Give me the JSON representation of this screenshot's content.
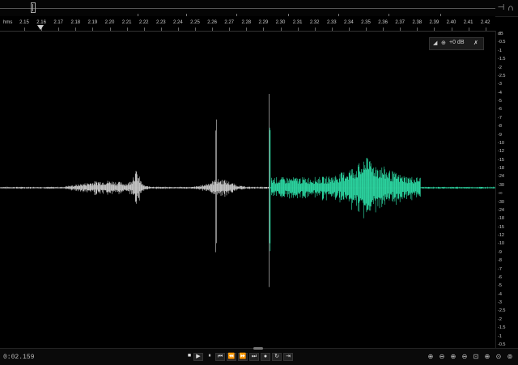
{
  "overview": {
    "end_icon": "⊣",
    "zoom_icon": "∩"
  },
  "ruler": {
    "unit": "hms",
    "ticks": [
      "2.15",
      "2.16",
      "2.17",
      "2.18",
      "2.19",
      "2.20",
      "2.21",
      "2.22",
      "2.23",
      "2.24",
      "2.25",
      "2.26",
      "2.27",
      "2.28",
      "2.29",
      "2.30",
      "2.31",
      "2.32",
      "2.33",
      "2.34",
      "2.35",
      "2.36",
      "2.37",
      "2.38",
      "2.39",
      "2.40",
      "2.41",
      "2.42"
    ]
  },
  "db_scale": {
    "labels": [
      "dB",
      "-0.5",
      "-1",
      "-1.5",
      "-2",
      "-2.5",
      "-3",
      "-4",
      "-5",
      "-6",
      "-7",
      "-8",
      "-9",
      "-10",
      "-12",
      "-15",
      "-18",
      "-24",
      "-30",
      "-∞",
      "-30",
      "-24",
      "-18",
      "-15",
      "-12",
      "-10",
      "-9",
      "-8",
      "-7",
      "-6",
      "-5",
      "-4",
      "-3",
      "-2.5",
      "-2",
      "-1.5",
      "-1",
      "-0.5"
    ]
  },
  "hud": {
    "label": "+0 dB",
    "icons": [
      "level-icon",
      "knob-icon",
      "pin-icon"
    ]
  },
  "status": {
    "timecode": "0:02.159"
  },
  "colors": {
    "waveform": "#d8d8d8",
    "selection": "#2fe6ad",
    "background": "#000000"
  }
}
